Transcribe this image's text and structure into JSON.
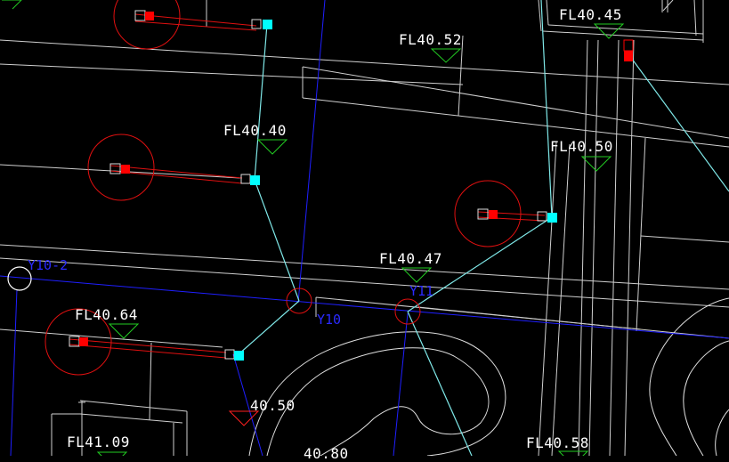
{
  "colors": {
    "background": "#000000",
    "wall": "#d0d0d0",
    "contour": "#e0e0e0",
    "pipe_cyan": "#7fe8e8",
    "grid_blue": "#1f1fff",
    "circle_red": "#e01010",
    "marker_red": "#ff0000",
    "marker_cyan": "#00ffff",
    "level_triangle": "#22cc22",
    "text": "#ffffff",
    "grid_text": "#2a2aff"
  },
  "level_labels": {
    "fl4045": "FL40.45",
    "fl4052": "FL40.52",
    "fl4040": "FL40.40",
    "fl4050": "FL40.50",
    "fl4047": "FL40.47",
    "fl4064": "FL40.64",
    "fl4109": "FL41.09",
    "fl4058": "FL40.58",
    "spot4050": "40.50",
    "spot4080": "40.80"
  },
  "grid_labels": {
    "y10_2": "Y10-2",
    "y10": "Y10",
    "y11": "Y11"
  }
}
